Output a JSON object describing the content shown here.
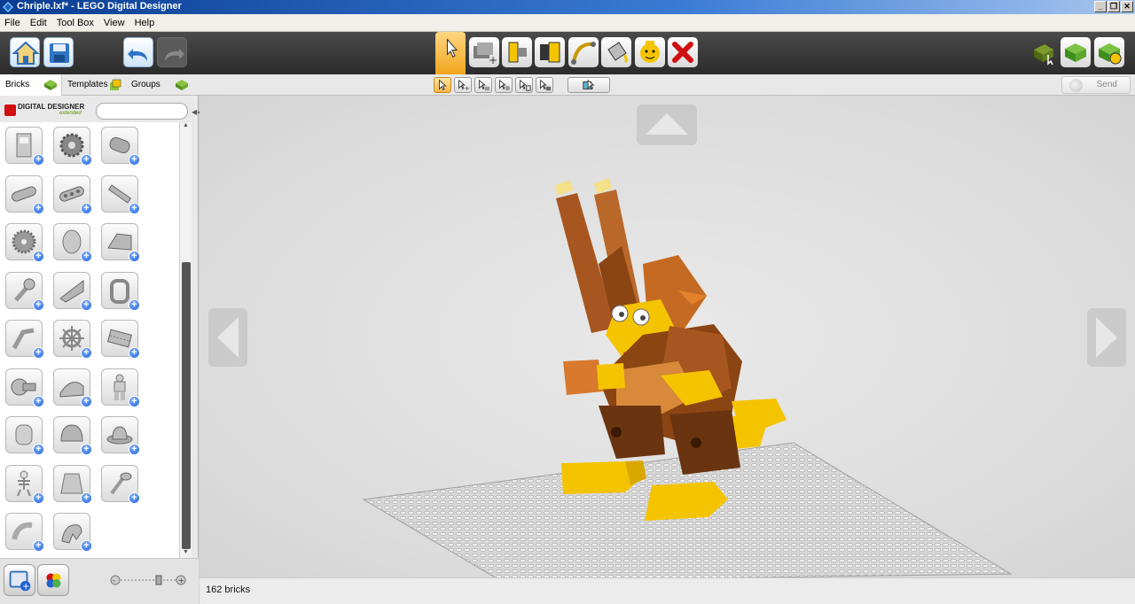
{
  "window": {
    "title": "Chriple.lxf* - LEGO Digital Designer",
    "minimize": "_",
    "restore": "❐",
    "close": "✕"
  },
  "menu": [
    "File",
    "Edit",
    "Tool Box",
    "View",
    "Help"
  ],
  "toolbar": {
    "home_icon": "home-icon",
    "save_icon": "save-icon",
    "undo_icon": "undo-icon",
    "redo_icon": "redo-icon",
    "tools": [
      "select-tool",
      "clone-tool",
      "hinge-tool",
      "hinge-align-tool",
      "flex-tool",
      "paint-tool",
      "decorate-tool",
      "delete-tool"
    ],
    "mode_icons": [
      "build-mode",
      "view-mode",
      "building-guide-mode"
    ]
  },
  "tabs": [
    {
      "label": "Bricks",
      "icon": "brick-green-icon"
    },
    {
      "label": "Templates",
      "icon": "templates-icon"
    },
    {
      "label": "Groups",
      "icon": "groups-icon"
    }
  ],
  "send": {
    "label": "Send"
  },
  "brand": {
    "line1": "DIGITAL DESIGNER",
    "line2": "extended"
  },
  "search": {
    "placeholder": "",
    "value": ""
  },
  "bricks": [
    "door-brick",
    "gear-brick",
    "technic-axle-connector",
    "technic-beam",
    "technic-beam-holes",
    "technic-axle",
    "gear-wheel",
    "cylinder-brick",
    "slope-brick",
    "wrench-part",
    "wing-part",
    "frame-part",
    "robot-arm-part",
    "ship-wheel",
    "crane-part",
    "pipe-connector",
    "curved-brick",
    "minifigure",
    "minifig-head",
    "helmet",
    "hat",
    "skeleton",
    "torso",
    "key-tool",
    "hose-piece",
    "animal-part"
  ],
  "status": {
    "brick_count": "162 bricks"
  },
  "colors": {
    "accent_orange": "#f1a51c",
    "toolbar_dark": "#2b2b2b",
    "model_brown": "#8b4513",
    "model_yellow": "#f5c400"
  }
}
